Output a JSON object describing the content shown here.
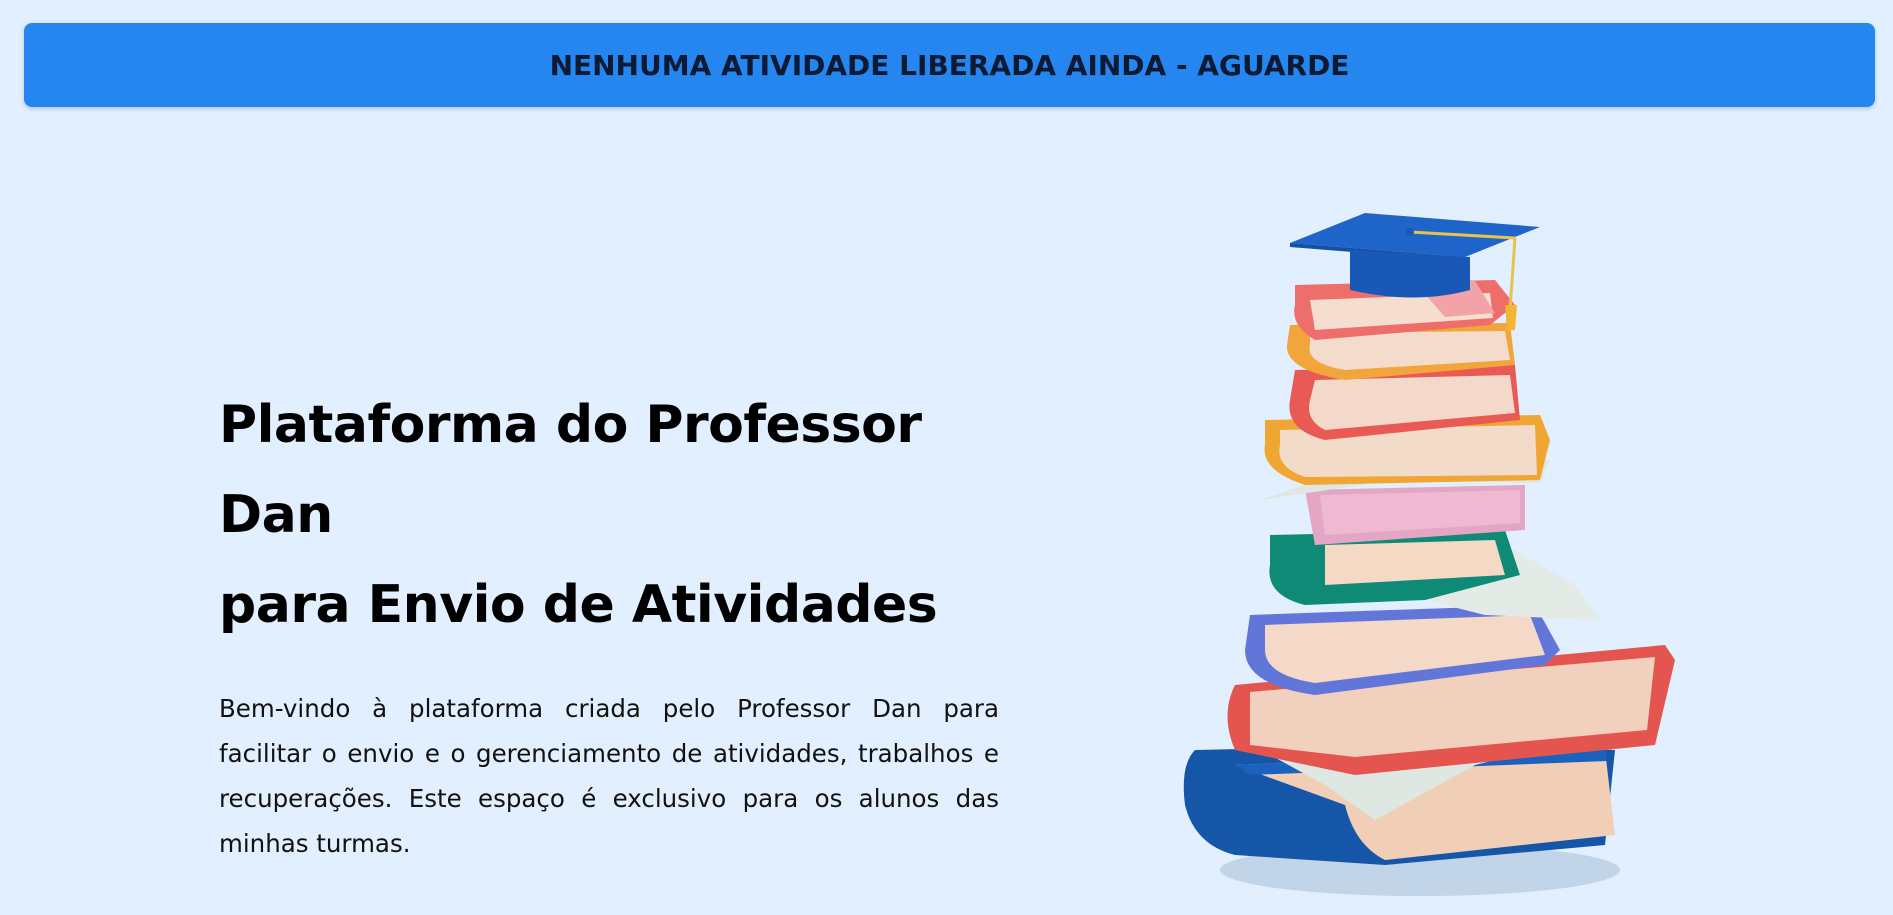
{
  "banner": {
    "text": "NENHUMA ATIVIDADE LIBERADA AINDA - AGUARDE",
    "color": "#2686f0"
  },
  "hero": {
    "title_line1": "Plataforma do Professor Dan",
    "title_line2": "para Envio de Atividades",
    "description": "Bem-vindo à plataforma criada pelo Professor Dan para facilitar o envio e o gerenciamento de atividades, trabalhos e recuperações. Este espaço é exclusivo para os alunos das minhas turmas."
  },
  "illustration": {
    "icon": "stack-of-books-with-graduation-cap"
  },
  "colors": {
    "background": "#e1efff",
    "accent": "#2686f0"
  }
}
